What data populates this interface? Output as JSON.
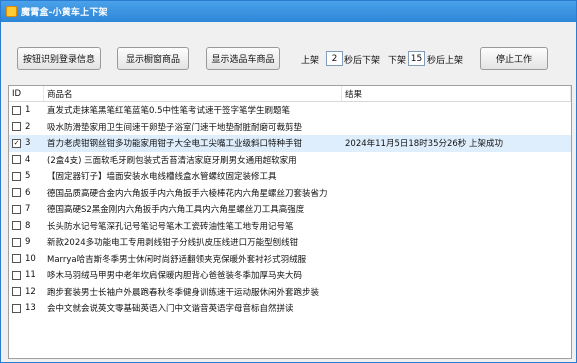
{
  "window": {
    "title": "魔霄盒-小黄车上下架"
  },
  "toolbar": {
    "btn_login": "按钮识别登录信息",
    "btn_showcase": "显示橱窗商品",
    "btn_cart": "显示选品车商品",
    "label_up": "上架",
    "up_value": "2",
    "label_up_after": "秒后下架",
    "label_down": "下架",
    "down_value": "15",
    "label_down_after": "秒后上架",
    "btn_stop": "停止工作"
  },
  "table": {
    "headers": {
      "id": "ID",
      "name": "商品名",
      "result": "结果"
    },
    "rows": [
      {
        "id": "1",
        "name": "直发式走抹笔黑笔红笔蓝笔0.5中性笔考试速干签字笔学生刷题笔",
        "result": "",
        "checked": false
      },
      {
        "id": "2",
        "name": "吸水防滑垫家用卫生间速干卵垫子浴室门速干地垫耐脏耐磨可裁剪垫",
        "result": "",
        "checked": false
      },
      {
        "id": "3",
        "name": "首力老虎钳钢丝钳多功能家用钳子大全电工尖嘴工业级斜口特种手钳",
        "result": "2024年11月5日18时35分26秒 上架成功",
        "checked": true
      },
      {
        "id": "4",
        "name": "(2盒4支) 三面软毛牙刷包装式舌苔清洁家庭牙刷男女通用超软家用",
        "result": "",
        "checked": false
      },
      {
        "id": "5",
        "name": "【固定器钉子】墙面安装水电线槽线盒水管螺纹固定装修工具",
        "result": "",
        "checked": false
      },
      {
        "id": "6",
        "name": "德国品质高硬合金内六角扳手内六角扳手六棱棒花内六角星螺丝刀套装省力",
        "result": "",
        "checked": false
      },
      {
        "id": "7",
        "name": "德国高硬S2黑金刚内六角扳手内六角工具内六角星螺丝刀工具高强度",
        "result": "",
        "checked": false
      },
      {
        "id": "8",
        "name": "长头防水记号笔深孔记号笔记号笔木工瓷砖油性笔工地专用记号笔",
        "result": "",
        "checked": false
      },
      {
        "id": "9",
        "name": "新款2024多功能电工专用剥线钳子分线扒皮压线进口万能型刨线钳",
        "result": "",
        "checked": false
      },
      {
        "id": "10",
        "name": "Marrya哈吉斯冬季男士休闲时尚舒适翻领夹克保暖外套衬衫式羽绒服",
        "result": "",
        "checked": false
      },
      {
        "id": "11",
        "name": "哆木马羽绒马甲男中老年坎肩保暖内胆背心爸爸装冬季加厚马夹大码",
        "result": "",
        "checked": false
      },
      {
        "id": "12",
        "name": "跑步套装男士长袖户外晨跑春秋冬季健身训练速干运动服休闲外套跑步装",
        "result": "",
        "checked": false
      },
      {
        "id": "13",
        "name": "会中文就会说英文零基础英语入门中文谐音英语字母音标自然拼读",
        "result": "",
        "checked": false
      }
    ]
  },
  "colors": {
    "title_bar": "#2e86d8",
    "selected_row": "#dfeefc"
  }
}
